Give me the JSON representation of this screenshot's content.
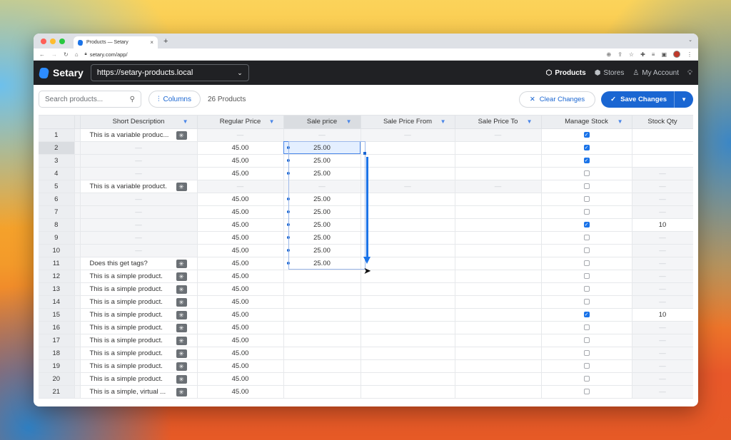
{
  "browser": {
    "tab_title": "Products — Setary",
    "tab_close": "×",
    "new_tab": "+",
    "url": "setary.com/app/",
    "traffic_lights": [
      "#ff5f57",
      "#febc2e",
      "#28c840"
    ]
  },
  "app": {
    "brand": "Setary",
    "site_url": "https://setary-products.local",
    "nav": [
      {
        "label": "Products",
        "icon": "cube-icon",
        "active": true
      },
      {
        "label": "Stores",
        "icon": "stack-icon",
        "active": false
      },
      {
        "label": "My Account",
        "icon": "user-icon",
        "active": false
      }
    ]
  },
  "toolbar": {
    "search_placeholder": "Search products...",
    "columns_label": "Columns",
    "product_count": "26 Products",
    "clear_label": "Clear Changes",
    "save_label": "Save Changes"
  },
  "colors": {
    "accent": "#1a66d2",
    "appbar": "#202124"
  },
  "table": {
    "columns": [
      "Short Description",
      "Regular Price",
      "Sale price",
      "Sale Price From",
      "Sale Price To",
      "Manage Stock",
      "Stock Qty"
    ],
    "rows": [
      {
        "n": "1",
        "desc": "This is a variable produc...",
        "tag": true,
        "reg": "",
        "sale": "",
        "from": "",
        "to": "",
        "ro": true,
        "stock": true,
        "qty": ""
      },
      {
        "n": "2",
        "desc": "",
        "tag": false,
        "reg": "45.00",
        "sale": "25.00",
        "from": "",
        "to": "",
        "ro": false,
        "stock": true,
        "qty": ""
      },
      {
        "n": "3",
        "desc": "",
        "tag": false,
        "reg": "45.00",
        "sale": "25.00",
        "from": "",
        "to": "",
        "ro": false,
        "stock": true,
        "qty": ""
      },
      {
        "n": "4",
        "desc": "",
        "tag": false,
        "reg": "45.00",
        "sale": "25.00",
        "from": "",
        "to": "",
        "ro": false,
        "stock": false,
        "qty": "—"
      },
      {
        "n": "5",
        "desc": "This is a variable product.",
        "tag": true,
        "reg": "",
        "sale": "",
        "from": "",
        "to": "",
        "ro": true,
        "stock": false,
        "qty": "—"
      },
      {
        "n": "6",
        "desc": "",
        "tag": false,
        "reg": "45.00",
        "sale": "25.00",
        "from": "",
        "to": "",
        "ro": false,
        "stock": false,
        "qty": "—"
      },
      {
        "n": "7",
        "desc": "",
        "tag": false,
        "reg": "45.00",
        "sale": "25.00",
        "from": "",
        "to": "",
        "ro": false,
        "stock": false,
        "qty": "—"
      },
      {
        "n": "8",
        "desc": "",
        "tag": false,
        "reg": "45.00",
        "sale": "25.00",
        "from": "",
        "to": "",
        "ro": false,
        "stock": true,
        "qty": "10"
      },
      {
        "n": "9",
        "desc": "",
        "tag": false,
        "reg": "45.00",
        "sale": "25.00",
        "from": "",
        "to": "",
        "ro": false,
        "stock": false,
        "qty": "—"
      },
      {
        "n": "10",
        "desc": "",
        "tag": false,
        "reg": "45.00",
        "sale": "25.00",
        "from": "",
        "to": "",
        "ro": false,
        "stock": false,
        "qty": "—"
      },
      {
        "n": "11",
        "desc": "Does this get tags?",
        "tag": true,
        "reg": "45.00",
        "sale": "25.00",
        "from": "",
        "to": "",
        "ro": false,
        "stock": false,
        "qty": "—"
      },
      {
        "n": "12",
        "desc": "This is a simple product.",
        "tag": true,
        "reg": "45.00",
        "sale": "",
        "from": "",
        "to": "",
        "ro": false,
        "stock": false,
        "qty": "—"
      },
      {
        "n": "13",
        "desc": "This is a simple product.",
        "tag": true,
        "reg": "45.00",
        "sale": "",
        "from": "",
        "to": "",
        "ro": false,
        "stock": false,
        "qty": "—"
      },
      {
        "n": "14",
        "desc": "This is a simple product.",
        "tag": true,
        "reg": "45.00",
        "sale": "",
        "from": "",
        "to": "",
        "ro": false,
        "stock": false,
        "qty": "—"
      },
      {
        "n": "15",
        "desc": "This is a simple product.",
        "tag": true,
        "reg": "45.00",
        "sale": "",
        "from": "",
        "to": "",
        "ro": false,
        "stock": true,
        "qty": "10"
      },
      {
        "n": "16",
        "desc": "This is a simple product.",
        "tag": true,
        "reg": "45.00",
        "sale": "",
        "from": "",
        "to": "",
        "ro": false,
        "stock": false,
        "qty": "—"
      },
      {
        "n": "17",
        "desc": "This is a simple product.",
        "tag": true,
        "reg": "45.00",
        "sale": "",
        "from": "",
        "to": "",
        "ro": false,
        "stock": false,
        "qty": "—"
      },
      {
        "n": "18",
        "desc": "This is a simple product.",
        "tag": true,
        "reg": "45.00",
        "sale": "",
        "from": "",
        "to": "",
        "ro": false,
        "stock": false,
        "qty": "—"
      },
      {
        "n": "19",
        "desc": "This is a simple product.",
        "tag": true,
        "reg": "45.00",
        "sale": "",
        "from": "",
        "to": "",
        "ro": false,
        "stock": false,
        "qty": "—"
      },
      {
        "n": "20",
        "desc": "This is a simple product.",
        "tag": true,
        "reg": "45.00",
        "sale": "",
        "from": "",
        "to": "",
        "ro": false,
        "stock": false,
        "qty": "—"
      },
      {
        "n": "21",
        "desc": "This is a simple, virtual ...",
        "tag": true,
        "reg": "45.00",
        "sale": "",
        "from": "",
        "to": "",
        "ro": false,
        "stock": false,
        "qty": "—"
      }
    ],
    "active_row": "2",
    "dash": "—"
  }
}
